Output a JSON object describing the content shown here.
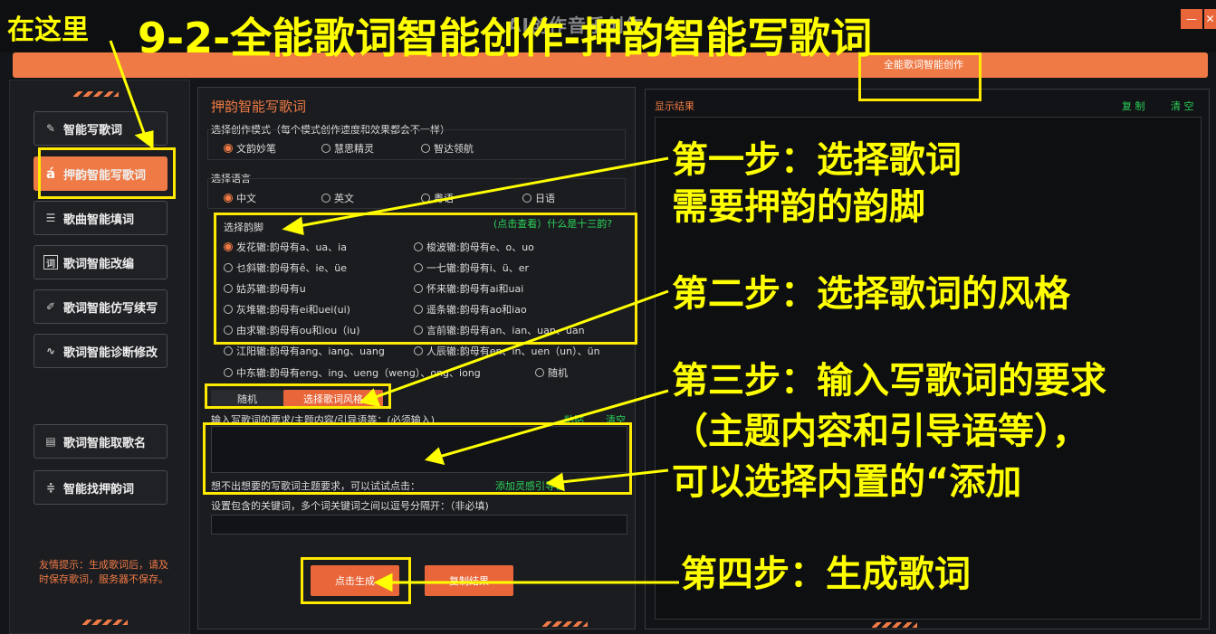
{
  "window": {
    "title": "9-2-全能歌词智能创作-押韵智能写歌词",
    "title_ghost": "AI创作音乐创作",
    "close": "✕",
    "minimize": "—"
  },
  "tabbar": {
    "active_tab": "全能歌词智能创作"
  },
  "sidebar": {
    "items": [
      {
        "label": "智能写歌词",
        "icon": "pen-icon"
      },
      {
        "label": "押韵智能写歌词",
        "icon": "rhyme-a-icon",
        "active": true
      },
      {
        "label": "歌曲智能填词",
        "icon": "bars-icon"
      },
      {
        "label": "歌词智能改编",
        "icon": "word-icon"
      },
      {
        "label": "歌词智能仿写续写",
        "icon": "pencil-icon"
      },
      {
        "label": "歌词智能诊断修改",
        "icon": "pulse-icon"
      },
      {
        "label": "歌词智能取歌名",
        "icon": "doc-icon"
      },
      {
        "label": "智能找押韵词",
        "icon": "sliders-icon"
      }
    ],
    "tips": "友情提示：生成歌词后，请及时保存歌词，服务器不保存。"
  },
  "main": {
    "title": "押韵智能写歌词",
    "mode_label": "选择创作模式（每个模式创作速度和效果都会不一样）",
    "modes": [
      "文韵妙笔",
      "慧思精灵",
      "智达领航"
    ],
    "language_label": "选择语言",
    "languages": [
      "中文",
      "英文",
      "粤语",
      "日语"
    ],
    "rhyme_label": "选择韵脚",
    "rhyme_link": "(点击查看）什么是十三韵?",
    "rhymes": [
      "发花辙:韵母有a、ua、ia",
      "梭波辙:韵母有e、o、uo",
      "乜斜辙:韵母有ê、ie、üe",
      "一七辙:韵母有i、ü、er",
      "姑苏辙:韵母有u",
      "怀来辙:韵母有ai和uai",
      "灰堆辙:韵母有ei和uei(ui)",
      "遥条辙:韵母有ao和iao",
      "由求辙:韵母有ou和iou（iu)",
      "言前辙:韵母有an、ian、uan、üan",
      "江阳辙:韵母有ang、iang、uang",
      "人辰辙:韵母有en、in、uen（un）、ün",
      "中东辙:韵母有eng、ing、ueng（weng）、ong、iong",
      "随机"
    ],
    "style_tabs": [
      "随机",
      "选择歌词风格"
    ],
    "req_label": "输入写歌词的要求/主题内容/引导语等：(必须输入)",
    "paste": "粘贴",
    "clear": "清空",
    "hint": "想不出想要的写歌词主题要求，可以试试点击：",
    "add_inspiration": "添加灵感引导语",
    "keyword_label": "设置包含的关键词，多个词关键词之间以逗号分隔开：（非必填)",
    "generate": "点击生成",
    "copy_result": "复制结果"
  },
  "result": {
    "title": "显示结果",
    "copy": "复 制",
    "clear": "清 空"
  },
  "annotations": {
    "here": "在这里",
    "step1_a": "第一步：选择歌词",
    "step1_b": "需要押韵的韵脚",
    "step2": "第二步：选择歌词的风格",
    "step3_a": "第三步：输入写歌词的要求",
    "step3_b": "（主题内容和引导语等），",
    "step3_c": "可以选择内置的“添加",
    "step4": "第四步：生成歌词"
  },
  "colors": {
    "accent": "#ef7a45",
    "annotation": "#ffff00",
    "green": "#2bd35a"
  }
}
